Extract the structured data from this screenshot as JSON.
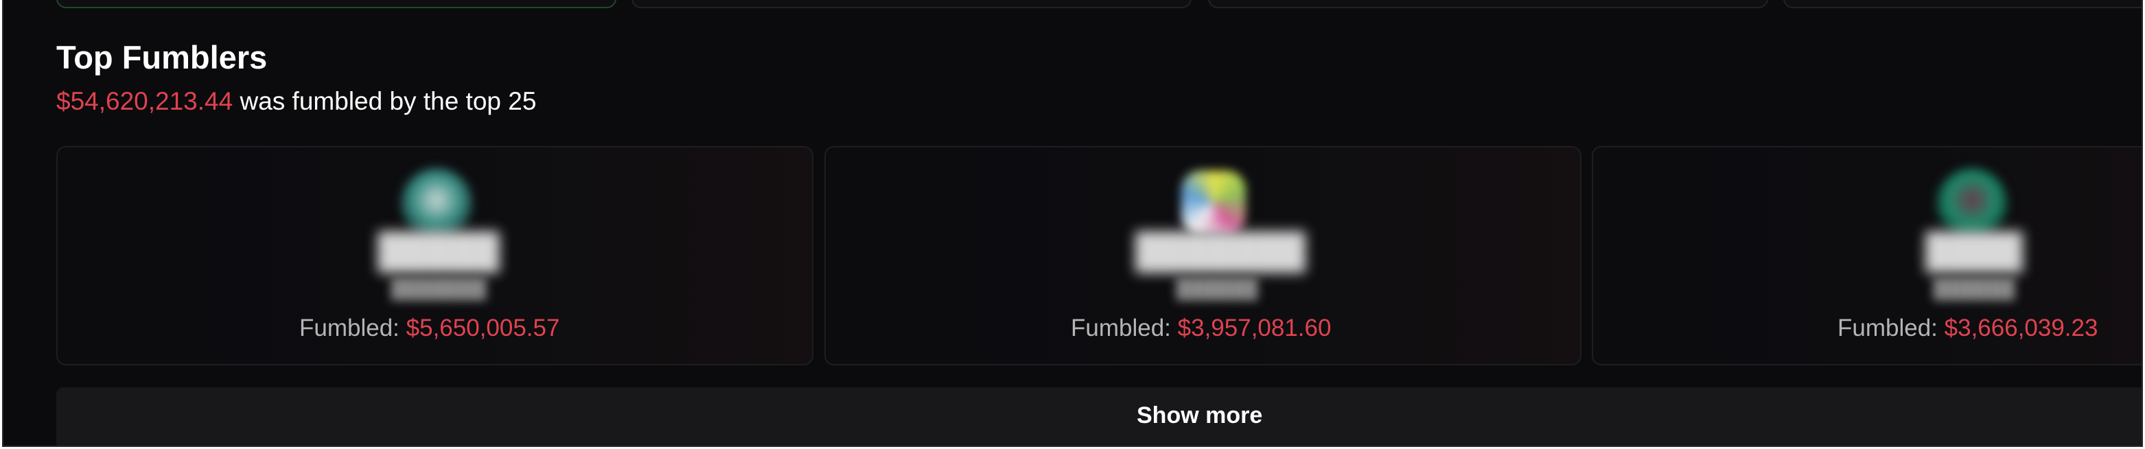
{
  "section": {
    "title": "Top Fumblers",
    "total_amount": "$54,620,213.44",
    "total_suffix": "was fumbled by the top 25"
  },
  "cards": [
    {
      "fumbled_label": "Fumbled:",
      "amount": "$5,650,005.57",
      "avatar_color": "#3a8f86"
    },
    {
      "fumbled_label": "Fumbled:",
      "amount": "$3,957,081.60",
      "avatar_color": "#8fbf5a"
    },
    {
      "fumbled_label": "Fumbled:",
      "amount": "$3,666,039.23",
      "avatar_color": "#1f8a6a"
    }
  ],
  "show_more": {
    "label": "Show more"
  },
  "colors": {
    "accent_red": "#e0434f",
    "background": "#0b0b0d",
    "card_border": "#1e1e22"
  }
}
